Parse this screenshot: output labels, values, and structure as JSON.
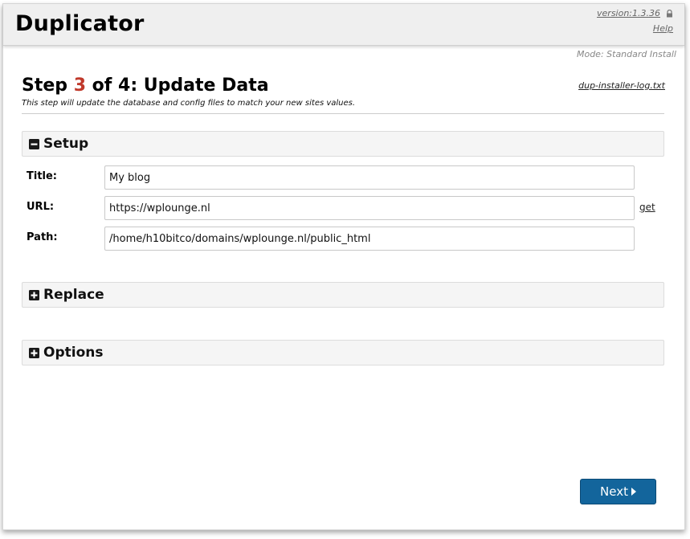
{
  "header": {
    "app_title": "Duplicator",
    "version_label": "version:1.3.36",
    "help_label": "Help",
    "mode_text": "Mode: Standard Install"
  },
  "step": {
    "prefix": "Step ",
    "number": "3",
    "suffix": " of 4: Update Data",
    "description": "This step will update the database and config files to match your new sites values.",
    "log_link": "dup-installer-log.txt"
  },
  "sections": {
    "setup": {
      "label": "Setup",
      "state": "expanded",
      "fields": {
        "title": {
          "label": "Title:",
          "value": "My blog"
        },
        "url": {
          "label": "URL:",
          "value": "https://wplounge.nl",
          "get_label": "get"
        },
        "path": {
          "label": "Path:",
          "value": "/home/h10bitco/domains/wplounge.nl/public_html"
        }
      }
    },
    "replace": {
      "label": "Replace",
      "state": "collapsed"
    },
    "options": {
      "label": "Options",
      "state": "collapsed"
    }
  },
  "footer": {
    "next_label": "Next"
  },
  "icons": {
    "lock": "lock-icon",
    "setup_toggle": "minus-square-icon",
    "replace_toggle": "plus-square-icon",
    "options_toggle": "plus-square-icon",
    "next_arrow": "caret-right-icon"
  },
  "colors": {
    "step_number": "#c0392b",
    "next_button": "#13659c",
    "header_bg": "#efefef"
  }
}
